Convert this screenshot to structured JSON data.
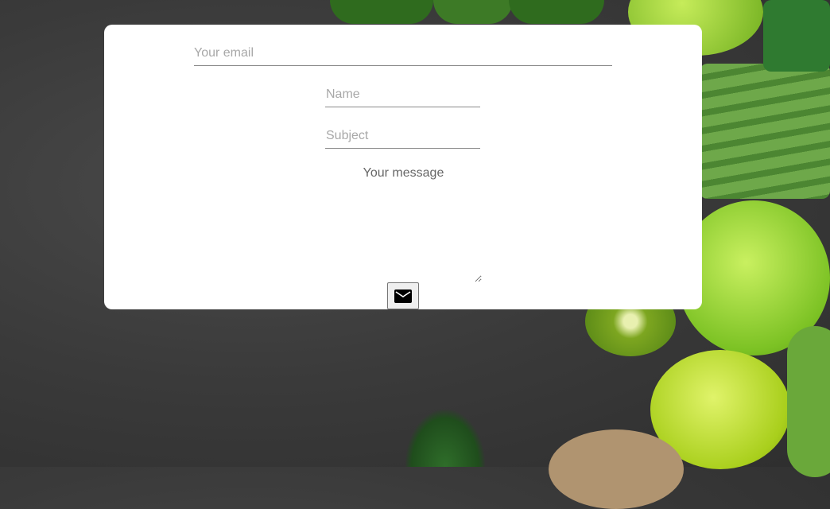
{
  "form": {
    "email_placeholder": "Your email",
    "name_placeholder": "Name",
    "subject_placeholder": "Subject",
    "message_placeholder": "Your message",
    "send_icon": "mail-icon"
  },
  "colors": {
    "card": "#ffffff",
    "background": "#3a3a3a",
    "accent_green": "#9acd32"
  }
}
